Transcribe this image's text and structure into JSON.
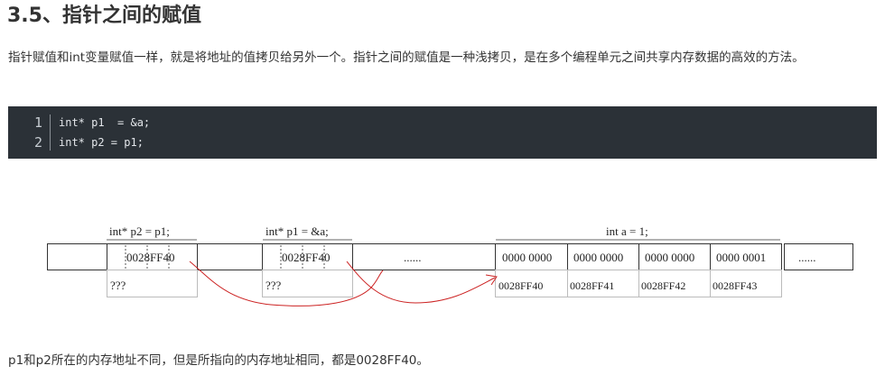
{
  "heading": "3.5、指针之间的赋值",
  "paragraph": "指针赋值和int变量赋值一样，就是将地址的值拷贝给另外一个。指针之间的赋值是一种浅拷贝，是在多个编程单元之间共享内存数据的高效的方法。",
  "code": {
    "lines": [
      {
        "num": "1",
        "text": "int* p1  = &a;"
      },
      {
        "num": "2",
        "text": "int* p2 = p1;"
      }
    ],
    "background": "#2b3137"
  },
  "diagram": {
    "labels": {
      "p2_decl": "int* p2 = p1;",
      "p1_decl": "int* p1 = &a;",
      "a_decl": "int a = 1;"
    },
    "cells": {
      "p2_value": "0028FF40",
      "p1_value": "0028FF40",
      "gap_ellipsis": "......",
      "byte0": "0000 0000",
      "byte1": "0000 0000",
      "byte2": "0000 0000",
      "byte3": "0000 0001",
      "end_ellipsis": "......"
    },
    "addresses": {
      "p2_addr": "???",
      "p1_addr": "???",
      "a0": "0028FF40",
      "a1": "0028FF41",
      "a2": "0028FF42",
      "a3": "0028FF43"
    },
    "arrow_color": "#cc2222"
  },
  "footer": "p1和p2所在的内存地址不同，但是所指向的内存地址相同，都是0028FF40。"
}
